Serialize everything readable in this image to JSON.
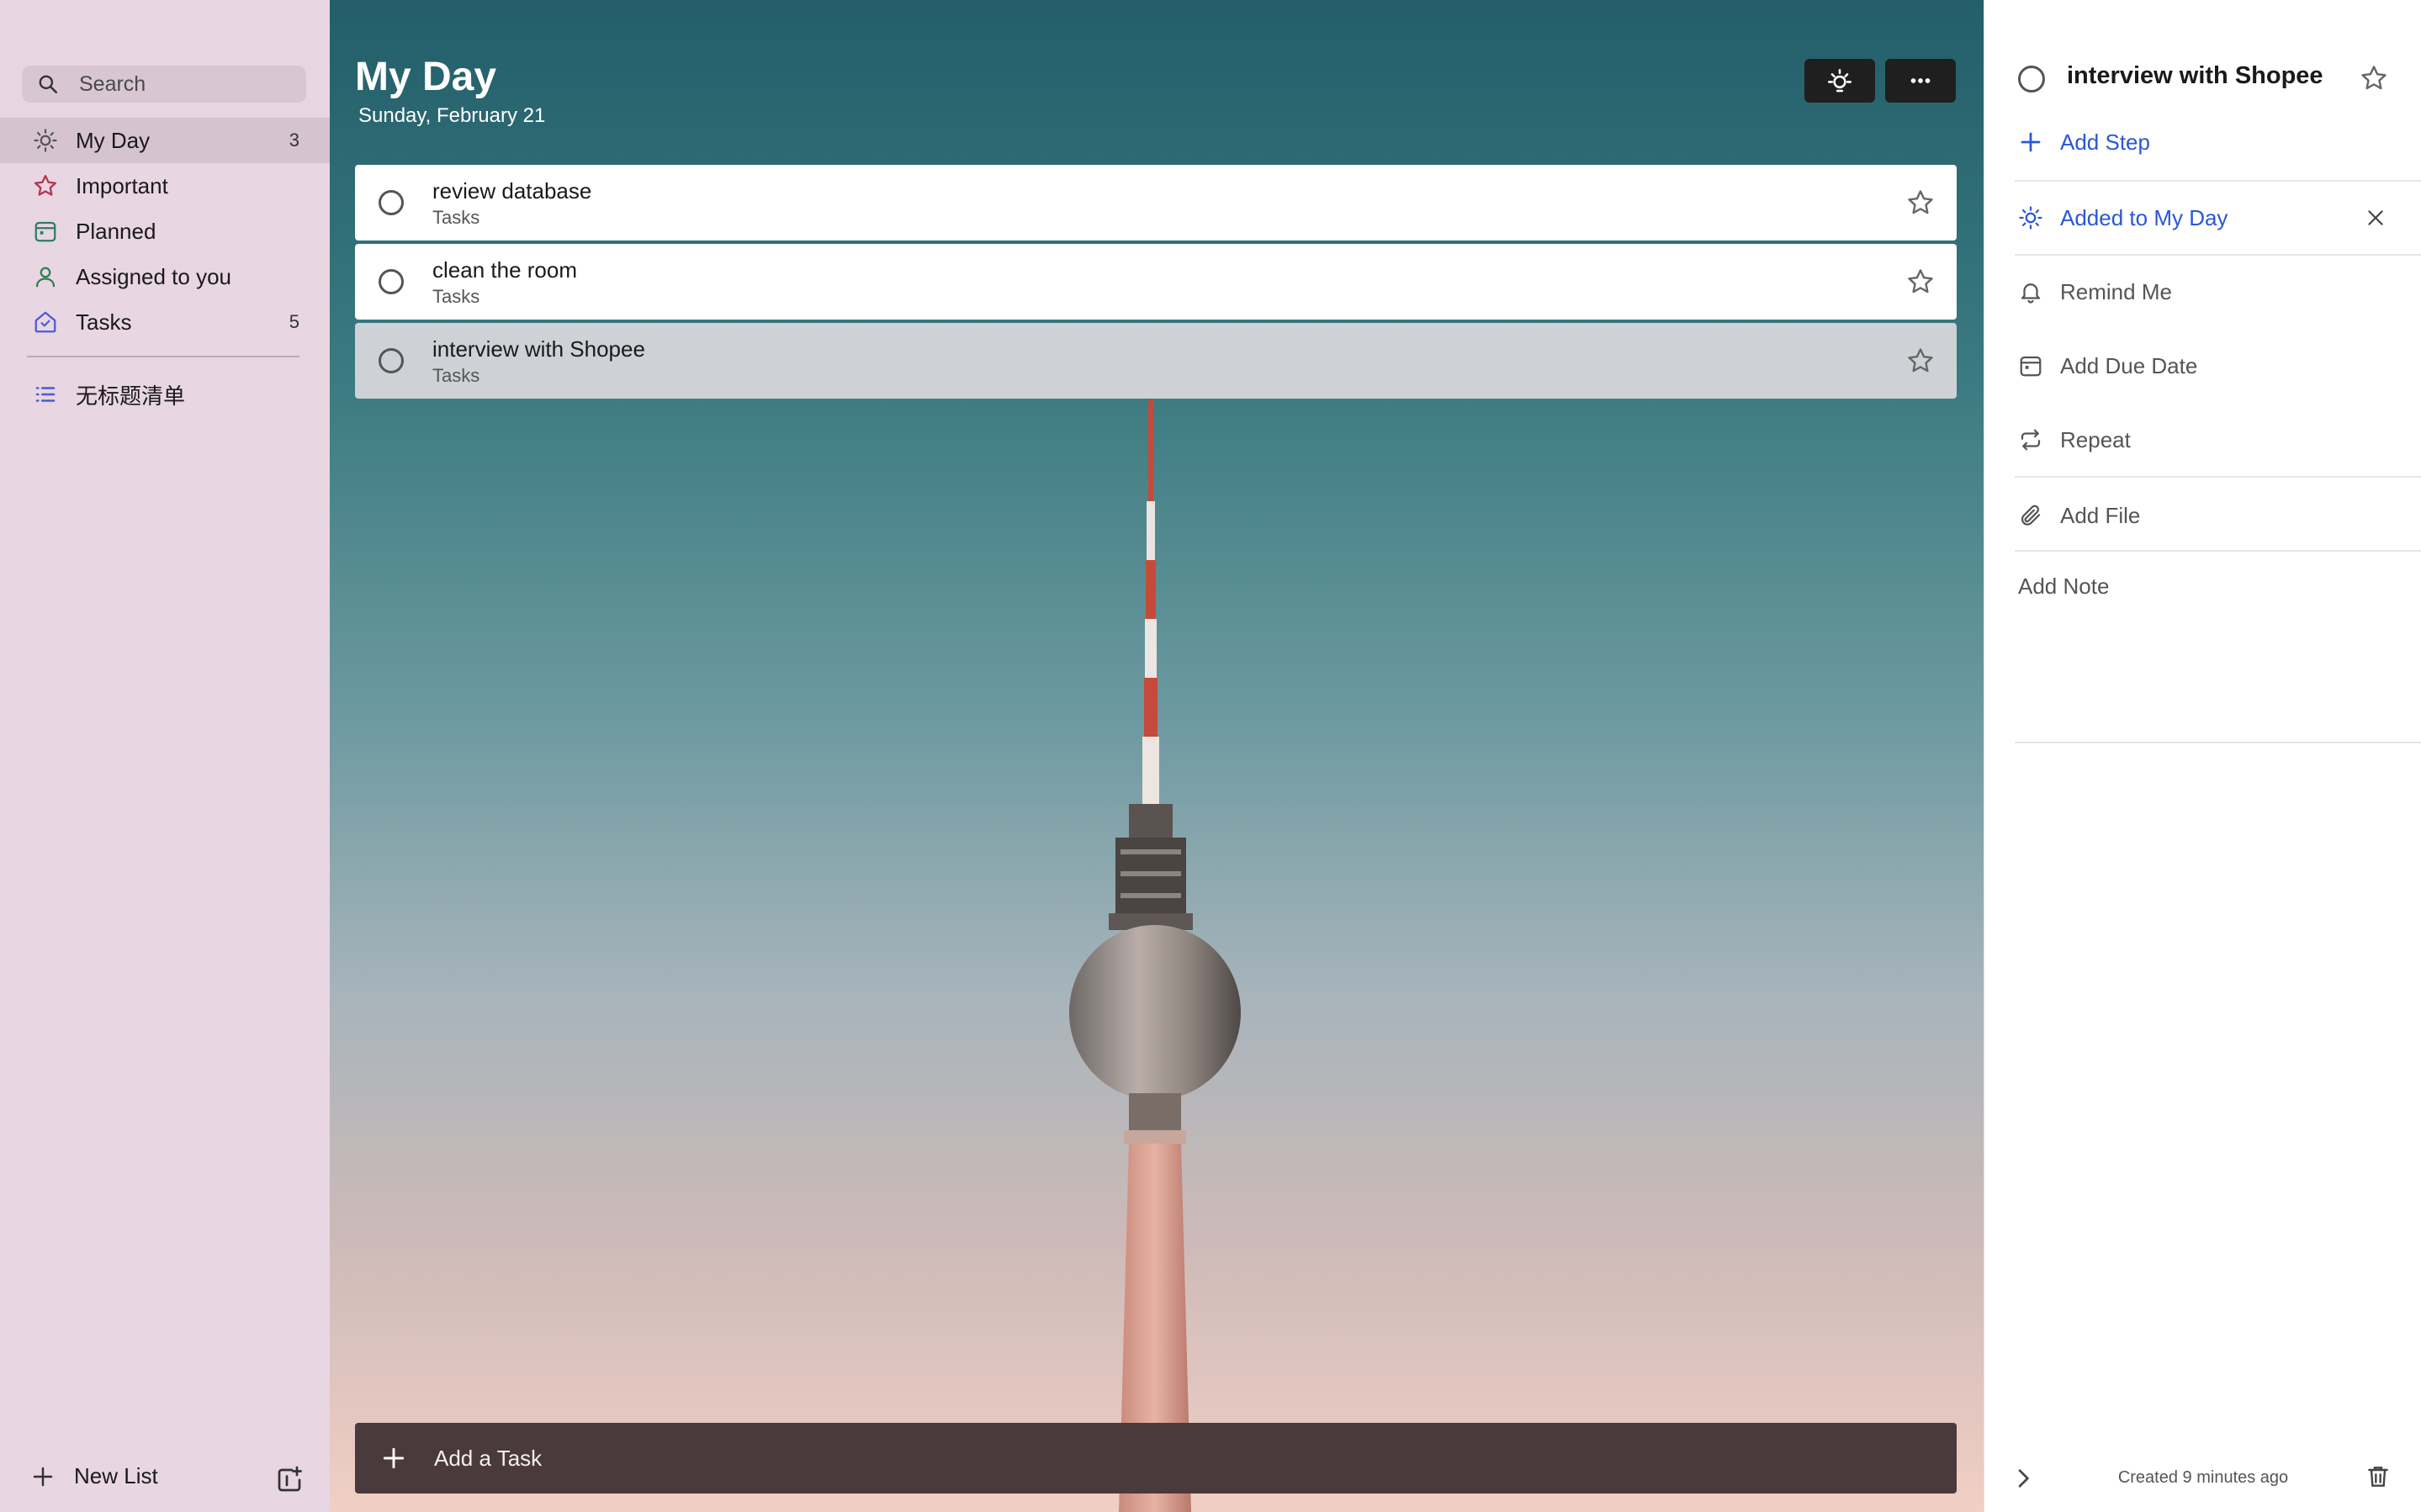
{
  "sidebar": {
    "search_placeholder": "Search",
    "nav": [
      {
        "label": "My Day",
        "count": "3"
      },
      {
        "label": "Important",
        "count": ""
      },
      {
        "label": "Planned",
        "count": ""
      },
      {
        "label": "Assigned to you",
        "count": ""
      },
      {
        "label": "Tasks",
        "count": "5"
      }
    ],
    "custom_lists": [
      {
        "label": "无标题清单"
      }
    ],
    "new_list_label": "New List"
  },
  "main": {
    "title": "My Day",
    "date": "Sunday, February 21",
    "tasks": [
      {
        "title": "review database",
        "list": "Tasks"
      },
      {
        "title": "clean the room",
        "list": "Tasks"
      },
      {
        "title": "interview with Shopee",
        "list": "Tasks"
      }
    ],
    "add_task_placeholder": "Add a Task"
  },
  "detail": {
    "title": "interview with Shopee",
    "add_step": "Add Step",
    "added_to_my_day": "Added to My Day",
    "remind_me": "Remind Me",
    "add_due_date": "Add Due Date",
    "repeat": "Repeat",
    "add_file": "Add File",
    "note_placeholder": "Add Note",
    "created": "Created 9 minutes ago"
  },
  "colors": {
    "accent_blue": "#2a56d8",
    "important_red": "#b5334d",
    "planned_teal": "#2f7a6e",
    "assigned_green": "#2e7d4f",
    "tasks_blue": "#4a5bd4"
  }
}
